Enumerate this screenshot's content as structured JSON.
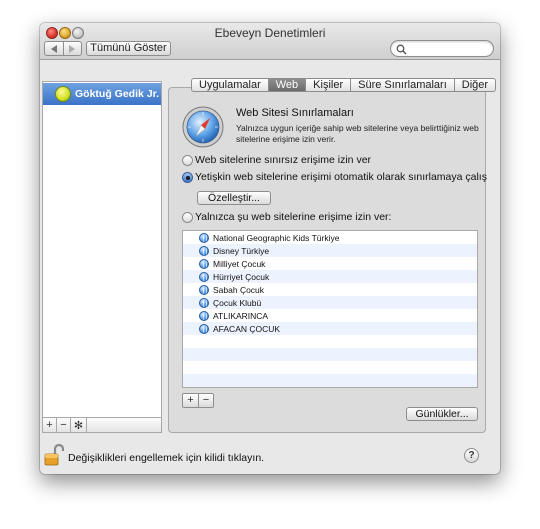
{
  "window": {
    "title": "Ebeveyn Denetimleri",
    "show_all_label": "Tümünü Göster",
    "search": {
      "placeholder": ""
    }
  },
  "sidebar": {
    "user_name": "Göktuğ Gedik Jr.",
    "add_label": "+",
    "remove_label": "−",
    "gear_label": "✻"
  },
  "tabs": [
    {
      "label": "Uygulamalar",
      "active": false
    },
    {
      "label": "Web",
      "active": true
    },
    {
      "label": "Kişiler",
      "active": false
    },
    {
      "label": "Süre Sınırlamaları",
      "active": false
    },
    {
      "label": "Diğer",
      "active": false
    }
  ],
  "web": {
    "section_title": "Web Sitesi Sınırlamaları",
    "section_description": "Yalnızca uygun içeriğe sahip web sitelerine veya belirttiğiniz web sitelerine erişime izin verir.",
    "option_unrestricted": "Web sitelerine sınırsız erişime izin ver",
    "option_adult_limit": "Yetişkin web sitelerine erişimi otomatik olarak sınırlamaya çalış",
    "customize_label": "Özelleştir...",
    "option_allow_only": "Yalnızca şu web sitelerine erişime izin ver:",
    "selected_option": "option_adult_limit",
    "sites": [
      "National Geographic Kids Türkiye",
      "Disney Türkiye",
      "Milliyet Çocuk",
      "Hürriyet Çocuk",
      "Sabah Çocuk",
      "Çocuk Klubü",
      "ATLIKARINCA",
      "AFACAN ÇOCUK"
    ],
    "add_site_label": "+",
    "remove_site_label": "−",
    "logs_label": "Günlükler..."
  },
  "footer": {
    "lock_text": "Değişiklikleri engellemek için kilidi tıklayın.",
    "help_label": "?"
  }
}
